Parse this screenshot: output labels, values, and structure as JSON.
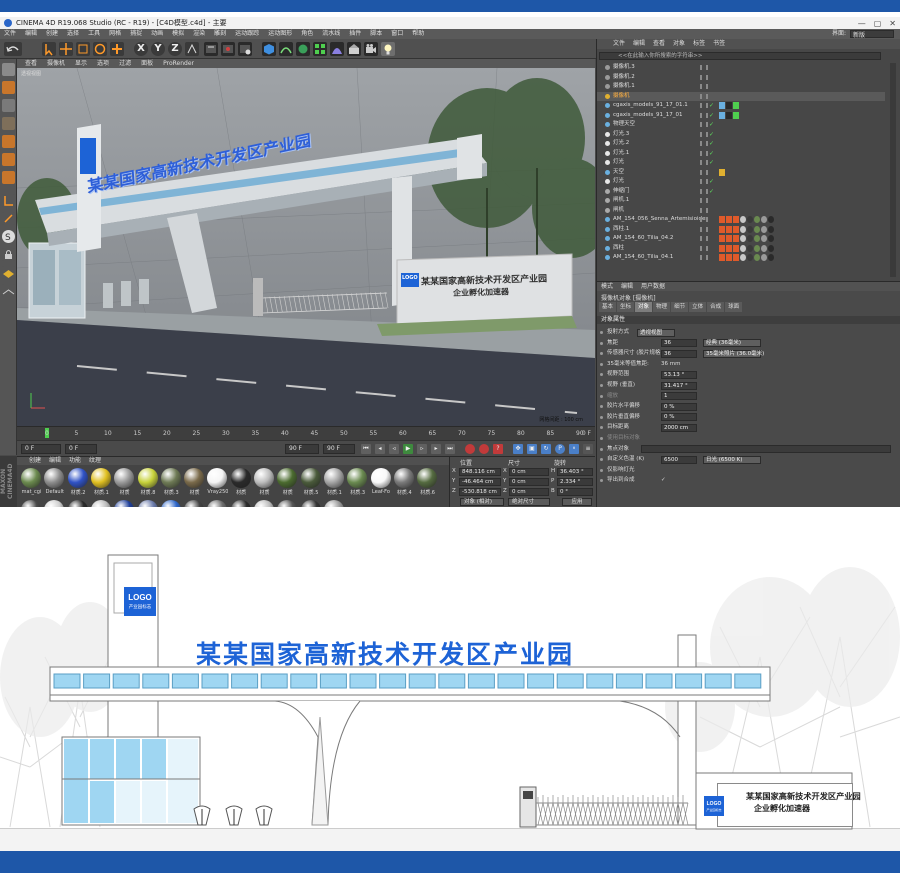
{
  "window": {
    "title": "CINEMA 4D R19.068 Studio (RC - R19) - [C4D模型.c4d] - 主要",
    "controls": [
      "—",
      "▢",
      "✕"
    ]
  },
  "menubar": {
    "items": [
      "文件",
      "编辑",
      "创建",
      "选择",
      "工具",
      "网格",
      "捕捉",
      "动画",
      "模拟",
      "渲染",
      "雕刻",
      "运动跟踪",
      "运动图形",
      "角色",
      "流水线",
      "插件",
      "脚本",
      "窗口",
      "帮助"
    ],
    "layout_label": "界面:",
    "layout_value": "新版"
  },
  "toolbar": {
    "axis_labels": [
      "X",
      "Y",
      "Z"
    ]
  },
  "viewport": {
    "menu": [
      "查看",
      "摄像机",
      "显示",
      "选项",
      "过滤",
      "面板",
      "ProRender"
    ],
    "label": "透视视图",
    "status": "网格间距 : 100 cm",
    "scene_title": "某某国家高新技术开发区产业园",
    "scene_sign_l1": "某某国家高新技术开发区产业园",
    "scene_sign_l2": "企业孵化加速器",
    "scene_logo": "LOGO"
  },
  "timeline": {
    "ticks": [
      "0",
      "5",
      "10",
      "15",
      "20",
      "25",
      "30",
      "35",
      "40",
      "45",
      "50",
      "55",
      "60",
      "65",
      "70",
      "75",
      "80",
      "85",
      "90"
    ],
    "end_label": "0 F"
  },
  "transport": {
    "start_field": "0 F",
    "start_field2": "0 F",
    "end_field": "90 F",
    "end_field2": "90 F"
  },
  "materials": {
    "menu": [
      "创建",
      "编辑",
      "功能",
      "纹理"
    ],
    "row1": [
      {
        "label": "mat_cgi",
        "color": "#6b8a4e"
      },
      {
        "label": "Default",
        "color": "#8d8d8d"
      },
      {
        "label": "材质.2",
        "color": "#2f52c6"
      },
      {
        "label": "材质.1",
        "color": "#e0c020"
      },
      {
        "label": "材质",
        "color": "#9a9a9a"
      },
      {
        "label": "材质.8",
        "color": "#c7d23a"
      },
      {
        "label": "材质.3",
        "color": "#6e7a55"
      },
      {
        "label": "材质",
        "color": "#7a6a4a"
      },
      {
        "label": "Vray250",
        "color": "#f5f5f5"
      },
      {
        "label": "材质",
        "color": "#2a2a2a"
      },
      {
        "label": "材质",
        "color": "#bdbdbd"
      },
      {
        "label": "材质",
        "color": "#4b6b2f"
      },
      {
        "label": "材质.5",
        "color": "#4a5a3a"
      },
      {
        "label": "材质.1",
        "color": "#a5a5a5"
      },
      {
        "label": "材质.3",
        "color": "#6a8a50"
      },
      {
        "label": "Leaf-Fo",
        "color": "#f8f8f8"
      },
      {
        "label": "材质.4",
        "color": "#7a7a7a"
      },
      {
        "label": "材质.6",
        "color": "#556b40"
      }
    ],
    "row2_colors": [
      "#4a4a4a",
      "#cfcfcf",
      "#2a2a2a",
      "#bcbcbc",
      "#1f3f9a",
      "#6a7aaa",
      "#2d66c9",
      "#444444",
      "#6c6c6c",
      "#2c2c2c",
      "#bdbdbd",
      "#555555",
      "#353535",
      "#999999"
    ]
  },
  "coordinates": {
    "headers": [
      "位置",
      "尺寸",
      "旋转"
    ],
    "rows": [
      {
        "axis": "X",
        "pos": "848.116 cm",
        "size_axis": "X",
        "size": "0 cm",
        "rot_axis": "H",
        "rot": "36.403 °"
      },
      {
        "axis": "Y",
        "pos": "-46.464 cm",
        "size_axis": "Y",
        "size": "0 cm",
        "rot_axis": "P",
        "rot": "2.334 °"
      },
      {
        "axis": "Z",
        "pos": "-530.818 cm",
        "size_axis": "Z",
        "size": "0 cm",
        "rot_axis": "B",
        "rot": "0 °"
      }
    ],
    "mode": "对象 (相对)",
    "size_mode": "绝对尺寸",
    "apply": "应用"
  },
  "object_manager": {
    "menu": [
      "文件",
      "编辑",
      "查看",
      "对象",
      "标签",
      "书签"
    ],
    "search_placeholder": "<<在此输入你所搜索的字符串>>",
    "rows": [
      {
        "name": "摄像机.3",
        "icon_color": "#9a9a9a",
        "selected": false,
        "check": false
      },
      {
        "name": "摄像机.2",
        "icon_color": "#9a9a9a",
        "selected": false,
        "check": false
      },
      {
        "name": "摄像机.1",
        "icon_color": "#9a9a9a",
        "selected": false,
        "check": false
      },
      {
        "name": "摄像机",
        "icon_color": "#e0b030",
        "selected": true,
        "check": false
      },
      {
        "name": "cgaxis_models_91_17_01.1",
        "icon_color": "#6ab0e0",
        "selected": false,
        "check": true
      },
      {
        "name": "cgaxis_models_91_17_01",
        "icon_color": "#6ab0e0",
        "selected": false,
        "check": true
      },
      {
        "name": "物理天空",
        "icon_color": "#6ab0e0",
        "selected": false,
        "check": true
      },
      {
        "name": "灯光.3",
        "icon_color": "#e8e8e8",
        "selected": false,
        "check": true
      },
      {
        "name": "灯光.2",
        "icon_color": "#e8e8e8",
        "selected": false,
        "check": true
      },
      {
        "name": "灯光.1",
        "icon_color": "#e8e8e8",
        "selected": false,
        "check": true
      },
      {
        "name": "灯光",
        "icon_color": "#e8e8e8",
        "selected": false,
        "check": true
      },
      {
        "name": "天空",
        "icon_color": "#6ab0e0",
        "selected": false,
        "check": false
      },
      {
        "name": "灯光",
        "icon_color": "#e8e8e8",
        "selected": false,
        "check": true
      },
      {
        "name": "伸缩门",
        "icon_color": "#aaaaaa",
        "selected": false,
        "check": true
      },
      {
        "name": "闸机.1",
        "icon_color": "#aaaaaa",
        "selected": false,
        "check": false
      },
      {
        "name": "闸机",
        "icon_color": "#aaaaaa",
        "selected": false,
        "check": false
      },
      {
        "name": "AM_154_056_Senna_Artemisioides",
        "icon_color": "#6ab0e0",
        "selected": false,
        "check": false
      },
      {
        "name": "西柱.1",
        "icon_color": "#6ab0e0",
        "selected": false,
        "check": false
      },
      {
        "name": "AM_154_60_Tilia_04.2",
        "icon_color": "#6ab0e0",
        "selected": false,
        "check": false
      },
      {
        "name": "西柱",
        "icon_color": "#6ab0e0",
        "selected": false,
        "check": false
      },
      {
        "name": "AM_154_60_Tilia_04.1",
        "icon_color": "#6ab0e0",
        "selected": false,
        "check": false
      }
    ]
  },
  "attribute_manager": {
    "menu": [
      "模式",
      "编辑",
      "用户数据"
    ],
    "object": "摄像机对象 [摄像机]",
    "tabs": [
      "基本",
      "坐标",
      "对象",
      "物理",
      "细节",
      "立体",
      "合成",
      "球面"
    ],
    "active_tab": "对象",
    "section": "对象属性",
    "rows": [
      {
        "label": "投射方式",
        "value": "透视视图",
        "kind": "dropdown"
      },
      {
        "label": "焦距",
        "value": "36",
        "kind": "field",
        "extra": "经典 (36毫米)"
      },
      {
        "label": "传感器尺寸 (胶片规格)",
        "value": "36",
        "kind": "field",
        "extra": "35毫米照片 (36.0毫米)"
      },
      {
        "label": "35毫米等值焦距:",
        "value": "36 mm",
        "kind": "text"
      },
      {
        "label": "视野范围",
        "value": "53.13 °",
        "kind": "field"
      },
      {
        "label": "视野 (垂直)",
        "value": "31.417 °",
        "kind": "field"
      },
      {
        "label": "缩放",
        "value": "1",
        "kind": "field",
        "dim": true
      },
      {
        "label": "胶片水平偏移",
        "value": "0 %",
        "kind": "field"
      },
      {
        "label": "胶片垂直偏移",
        "value": "0 %",
        "kind": "field"
      },
      {
        "label": "目标距离",
        "value": "2000 cm",
        "kind": "field"
      },
      {
        "label": "使用目标对象",
        "value": "",
        "kind": "text",
        "dim": true
      },
      {
        "label": "焦点对象",
        "value": "",
        "kind": "wide"
      },
      {
        "label": "自定义色温 (K)",
        "value": "6500",
        "kind": "field",
        "extra": "日光 (6500 K)"
      },
      {
        "label": "仅影响灯光",
        "value": "",
        "kind": "text"
      },
      {
        "label": "导出到合成",
        "value": "✓",
        "kind": "text"
      }
    ]
  },
  "elevation": {
    "title": "某某国家高新技术开发区产业园",
    "tower_logo": "LOGO",
    "tower_logo_sub": "产业园标志",
    "sign_logo": "LOGO",
    "sign_logo_sub": "产业园标志",
    "sign_line1": "某某国家高新技术开发区产业园",
    "sign_line2": "企业孵化加速器"
  },
  "colors": {
    "brand_blue": "#1d63d6",
    "frame_blue": "#1e57a8",
    "glass_blue": "#9fd6f2"
  }
}
